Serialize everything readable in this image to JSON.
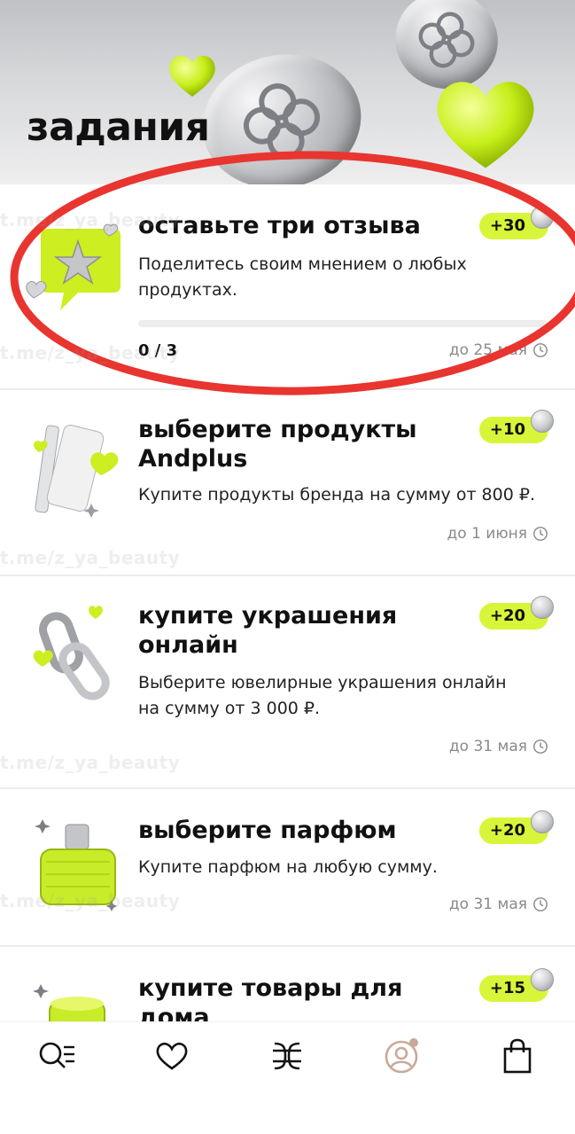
{
  "header": {
    "title": "задания"
  },
  "watermark": {
    "text": "t.me/z_ya_beauty"
  },
  "tasks": [
    {
      "title": "оставьте три отзыва",
      "description": "Поделитесь своим мнением о любых продуктах.",
      "reward": "+30",
      "progress_text": "0 / 3",
      "progress": 0,
      "deadline": "до 25 мая",
      "icon": "speech-bubble-star-icon"
    },
    {
      "title": "выберите продукты Andplus",
      "description": "Купите продукты бренда на сумму от 800 ₽.",
      "reward": "+10",
      "deadline": "до 1 июня",
      "icon": "cosmetics-tube-icon"
    },
    {
      "title": "купите украшения онлайн",
      "description": "Выберите ювелирные украшения онлайн на сумму от 3 000 ₽.",
      "reward": "+20",
      "deadline": "до 31 мая",
      "icon": "chain-links-icon"
    },
    {
      "title": "выберите парфюм",
      "description": "Купите парфюм на любую сумму.",
      "reward": "+20",
      "deadline": "до 31 мая",
      "icon": "perfume-bottle-icon"
    },
    {
      "title": "купите товары для дома",
      "description": "",
      "reward": "+15",
      "deadline": "",
      "icon": "candle-icon"
    }
  ],
  "tabbar": [
    {
      "name": "search",
      "icon": "search-catalog-icon",
      "active": false
    },
    {
      "name": "favorites",
      "icon": "heart-icon",
      "active": false
    },
    {
      "name": "brands",
      "icon": "brand-logo-icon",
      "active": false
    },
    {
      "name": "profile",
      "icon": "profile-icon",
      "active": true
    },
    {
      "name": "cart",
      "icon": "shopping-bag-icon",
      "active": false
    }
  ],
  "colors": {
    "accent": "#d9f53a",
    "annotation": "#e8352f",
    "active_tab": "#c9a99a"
  }
}
